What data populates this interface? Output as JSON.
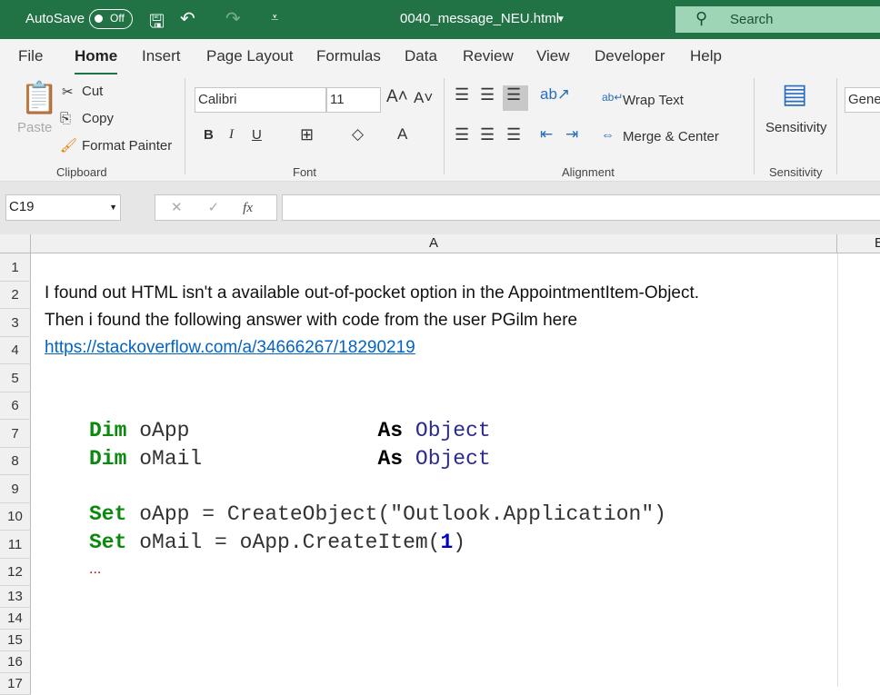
{
  "titlebar": {
    "autosave": "AutoSave",
    "autosave_state": "Off",
    "filename": "0040_message_NEU.html",
    "search": "Search"
  },
  "menu": [
    "File",
    "Home",
    "Insert",
    "Page Layout",
    "Formulas",
    "Data",
    "Review",
    "View",
    "Developer",
    "Help"
  ],
  "ribbon": {
    "paste": "Paste",
    "cut": "Cut",
    "copy": "Copy",
    "format_painter": "Format Painter",
    "clipboard": "Clipboard",
    "font_name": "Calibri",
    "font_size": "11",
    "font": "Font",
    "bold": "B",
    "italic": "I",
    "underline": "U",
    "wrap_text": "Wrap Text",
    "merge_center": "Merge & Center",
    "alignment": "Alignment",
    "sensitivity": "Sensitivity",
    "sensitivity_group": "Sensitivity",
    "number_format": "Gene"
  },
  "formula_bar": {
    "name_box": "C19",
    "fx": "fx",
    "value": ""
  },
  "columns": [
    "A",
    "B"
  ],
  "rows": [
    "1",
    "2",
    "3",
    "4",
    "5",
    "6",
    "7",
    "8",
    "9",
    "10",
    "11",
    "12",
    "13",
    "14",
    "15",
    "16",
    "17"
  ],
  "cells": {
    "r2": "I found out HTML isn't a available out-of-pocket option in the AppointmentItem-Object.",
    "r3": "Then i found the following answer with code from the user PGilm here",
    "r4": "https://stackoverflow.com/a/34666267/18290219",
    "r7": {
      "kw": "Dim",
      "var": " oApp            ",
      "as": "As",
      "type": " Object"
    },
    "r8": {
      "kw": "Dim",
      "var": " oMail           ",
      "as": "As",
      "type": " Object"
    },
    "r10": {
      "kw": "Set",
      "rest": " oApp = CreateObject(\"Outlook.Application\")"
    },
    "r11": {
      "kw": "Set",
      "rest": " oMail = oApp.CreateItem(",
      "num": "1",
      "close": ")"
    },
    "r12": "..."
  },
  "colors": {
    "accent": "#217346",
    "keyword": "#0a8a0a",
    "type": "#2b2b8f",
    "link": "#0563c1"
  }
}
